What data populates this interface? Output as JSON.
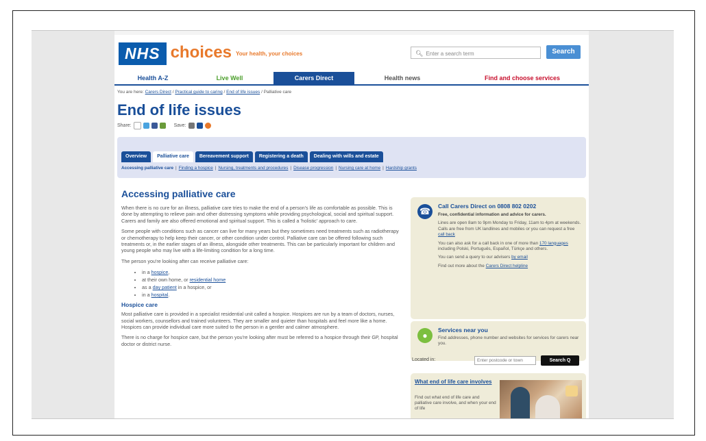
{
  "header": {
    "logo_nhs": "NHS",
    "logo_choices": "choices",
    "tagline": "Your health, your choices",
    "search_placeholder": "Enter a search term",
    "search_button": "Search"
  },
  "nav": [
    {
      "label": "Health A-Z",
      "color": "#1a4f99",
      "active": false
    },
    {
      "label": "Live Well",
      "color": "#4a9e2a",
      "active": false
    },
    {
      "label": "Carers Direct",
      "color": "#ffffff",
      "active": true
    },
    {
      "label": "Health news",
      "color": "#555555",
      "active": false
    },
    {
      "label": "Find and choose services",
      "color": "#c8102e",
      "active": false
    }
  ],
  "breadcrumb": {
    "prefix": "You are here:",
    "items": [
      "Carers Direct",
      "Practical guide to caring",
      "End of life issues"
    ],
    "current": "Palliative care"
  },
  "page_title": "End of life issues",
  "share_label": "Share:",
  "save_label": "Save:",
  "tabs": [
    "Overview",
    "Palliative care",
    "Bereavement support",
    "Registering a death",
    "Dealing with wills and estate"
  ],
  "active_tab": "Palliative care",
  "subnav": {
    "current": "Accessing palliative care",
    "links": [
      "Finding a hospice",
      "Nursing, treatments and procedures",
      "Disease progression",
      "Nursing care at home",
      "Hardship grants"
    ]
  },
  "article": {
    "heading": "Accessing palliative care",
    "p1": "When there is no cure for an illness, palliative care tries to make the end of a person's life as comfortable as possible. This is done by attempting to relieve pain and other distressing symptoms while providing psychological, social and spiritual support. Carers and family are also offered emotional and spiritual support. This is called a 'holistic' approach to care.",
    "p2": "Some people with conditions such as cancer can live for many years but they sometimes need treatments such as radiotherapy or chemotherapy to help keep their cancer, or other condition under control. Palliative care can be offered following such treatments or, in the earlier stages of an illness, alongside other treatments. This can be particularly important for children and young people who may live with a life-limiting condition for a long time.",
    "p3": "The person you're looking after can receive palliative care:",
    "list": [
      {
        "pre": "in a ",
        "link": "hospice",
        "post": ","
      },
      {
        "pre": "at their own home, or ",
        "link": "residential home",
        "post": ""
      },
      {
        "pre": "as a ",
        "link": "day patient",
        "post": " in a hospice, or"
      },
      {
        "pre": "in a ",
        "link": "hospital",
        "post": "."
      }
    ],
    "sub_heading": "Hospice care",
    "p4": "Most palliative care is provided in a specialist residential unit called a hospice. Hospices are run by a team of doctors, nurses, social workers, counsellors and trained volunteers. They are smaller and quieter than hospitals and feel more like a home. Hospices can provide individual care more suited to the person in a gentler and calmer atmosphere.",
    "p5": "There is no charge for hospice care, but the person you're looking after must be referred to a hospice through their GP, hospital doctor or district nurse."
  },
  "carers_box": {
    "title": "Call Carers Direct on 0808 802 0202",
    "subtitle": "Free, confidential information and advice for carers.",
    "p1": "Lines are open 8am to 9pm Monday to Friday, 11am to 4pm at weekends. Calls are free from UK landlines and mobiles or you can request a free",
    "p1_link": "call back",
    "p2": "You can also ask for a call back in one of more than",
    "p2_link": "170 languages",
    "p2_rest": "including Polski, Português, Español, Türkçe and others.",
    "p3": "You can send a query to our advisers",
    "p3_link": "by email",
    "p4": "Find out more about the",
    "p4_link": "Carers Direct helpline"
  },
  "services_box": {
    "title": "Services near you",
    "body": "Find addresses, phone number and websites for services for carers near you.",
    "located_label": "Located in:",
    "input_placeholder": "Enter postcode or town",
    "button": "Search Q"
  },
  "promo_box": {
    "title": "What end of life care involves",
    "body": "Find out what end of life care and palliative care involve, and when your end of life"
  }
}
